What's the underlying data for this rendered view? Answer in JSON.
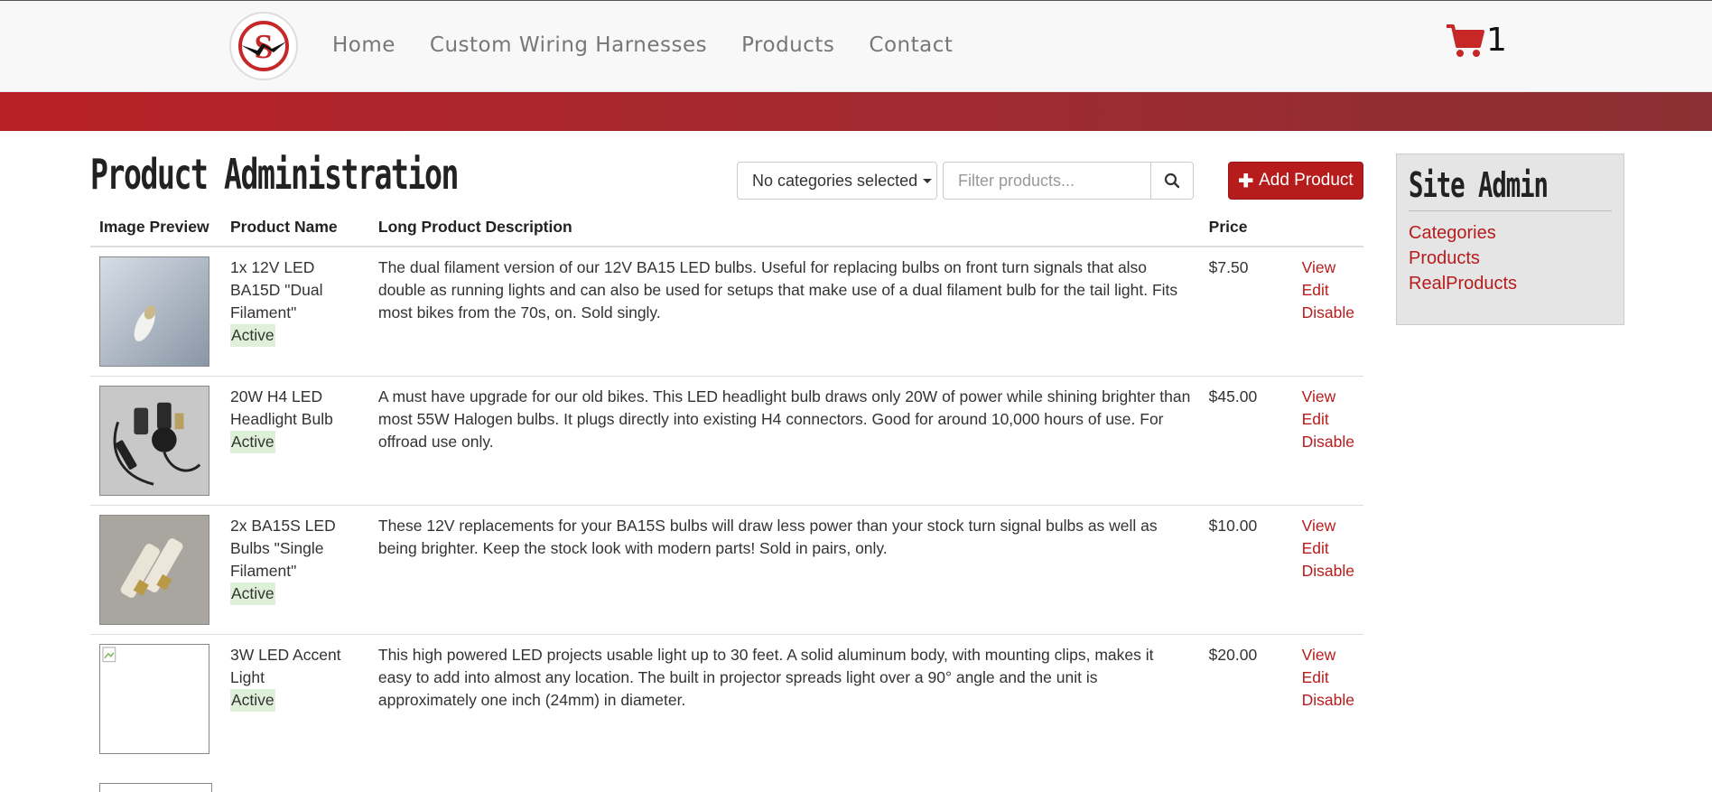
{
  "nav": {
    "logo_letter": "S",
    "links": [
      "Home",
      "Custom Wiring Harnesses",
      "Products",
      "Contact"
    ],
    "cart_count": "1"
  },
  "colors": {
    "brand_red": "#b71c1c",
    "status_active_bg": "#dff0d8"
  },
  "page": {
    "title": "Product Administration",
    "category_filter": "No categories selected",
    "filter_placeholder": "Filter products...",
    "add_button": "Add Product"
  },
  "table": {
    "headers": [
      "Image Preview",
      "Product Name",
      "Long Product Description",
      "Price"
    ],
    "rows": [
      {
        "name": "1x 12V LED BA15D \"Dual Filament\"",
        "status": "Active",
        "description": "The dual filament version of our 12V BA15 LED bulbs. Useful for replacing bulbs on front turn signals that also double as running lights and can also be used for setups that make use of a dual filament bulb for the tail light. Fits most bikes from the 70s, on. Sold singly.",
        "price": "$7.50",
        "actions": [
          "View",
          "Edit",
          "Disable"
        ]
      },
      {
        "name": "20W H4 LED Headlight Bulb",
        "status": "Active",
        "description": "A must have upgrade for our old bikes. This LED headlight bulb draws only 20W of power while shining brighter than most 55W Halogen bulbs. It plugs directly into existing H4 connectors. Good for around 10,000 hours of use. For offroad use only.",
        "price": "$45.00",
        "actions": [
          "View",
          "Edit",
          "Disable"
        ]
      },
      {
        "name": "2x BA15S LED Bulbs \"Single Filament\"",
        "status": "Active",
        "description": "These 12V replacements for your BA15S bulbs will draw less power than your stock turn signal bulbs as well as being brighter. Keep the stock look with modern parts! Sold in pairs, only.",
        "price": "$10.00",
        "actions": [
          "View",
          "Edit",
          "Disable"
        ]
      },
      {
        "name": "3W LED Accent Light",
        "status": "Active",
        "description": "This high powered LED projects usable light up to 30 feet. A solid aluminum body, with mounting clips, makes it easy to add into almost any location. The built in projector spreads light over a 90° angle and the unit is approximately one inch (24mm) in diameter.",
        "price": "$20.00",
        "actions": [
          "View",
          "Edit",
          "Disable"
        ]
      }
    ]
  },
  "sidebar": {
    "title": "Site Admin",
    "links": [
      "Categories",
      "Products",
      "RealProducts"
    ]
  }
}
